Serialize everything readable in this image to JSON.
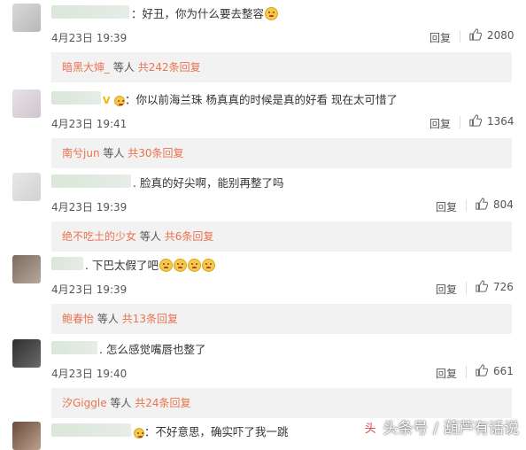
{
  "comments": [
    {
      "text": "好丑，你为什么要去整容",
      "emojis": [
        "smiley-icon"
      ],
      "date": "4月23日",
      "time": "19:39",
      "reply_label": "回复",
      "likes": "2080",
      "reply_summary": {
        "name": "暗黑大婶_",
        "mid": "等人",
        "count": "共242条回复"
      }
    },
    {
      "text": "你以前海兰珠 杨真真的时候是真的好看 现在太可惜了",
      "date": "4月23日",
      "time": "19:41",
      "reply_label": "回复",
      "likes": "1364",
      "reply_summary": {
        "name": "南兮jun",
        "mid": "等人",
        "count": "共30条回复"
      }
    },
    {
      "text": "脸真的好尖啊，能别再整了吗",
      "date": "4月23日",
      "time": "19:39",
      "reply_label": "回复",
      "likes": "804",
      "reply_summary": {
        "name": "绝不吃土的少女",
        "mid": "等人",
        "count": "共6条回复"
      }
    },
    {
      "text": "下巴太假了吧",
      "emojis": [
        "grimace-icon",
        "grimace-icon",
        "grimace-icon",
        "grimace-icon"
      ],
      "date": "4月23日",
      "time": "19:39",
      "reply_label": "回复",
      "likes": "726",
      "reply_summary": {
        "name": "鲍春怡",
        "mid": "等人",
        "count": "共13条回复"
      }
    },
    {
      "text": "怎么感觉嘴唇也整了",
      "date": "4月23日",
      "time": "19:40",
      "reply_label": "回复",
      "likes": "661",
      "reply_summary": {
        "name": "汐Giggle",
        "mid": "等人",
        "count": "共24条回复"
      }
    },
    {
      "text": "不好意思，确实吓了我一跳"
    }
  ],
  "watermark": {
    "brand": "头条号",
    "sep": "/",
    "account": "葫芦有话说"
  },
  "colors": {
    "link": "#eb7350",
    "reply_bg": "#f2f2f2",
    "text": "#333333"
  }
}
